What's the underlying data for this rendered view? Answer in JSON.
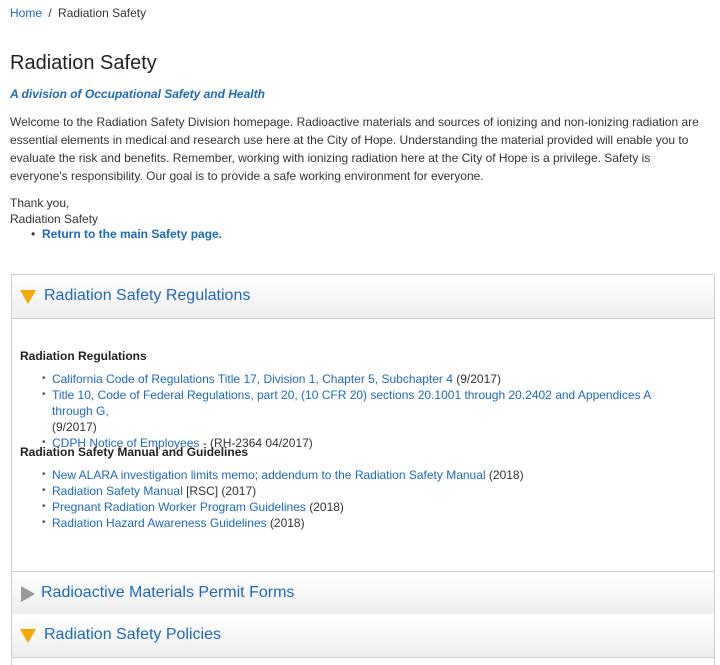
{
  "breadcrumb": {
    "home": "Home",
    "separator": "/",
    "current": "Radiation Safety"
  },
  "page": {
    "title": "Radiation Safety",
    "subtitle": "A division of Occupational Safety and Health",
    "intro": "Welcome to the Radiation Safety Division homepage. Radioactive materials and sources of ionizing and non-ionizing radiation are essential elements in medical and research use here at the City of Hope. Understanding the material provided will enable you to evaluate the risk and benefits. Remember, working with ionizing radiation here at the City of Hope is a privilege. Safety is everyone's responsibility. Our goal is to provide a safe working environment for everyone.",
    "thanks_line": "Thank you,",
    "signature": "Radiation Safety",
    "return_link": "Return to the main Safety page."
  },
  "accordion": {
    "panels": [
      {
        "title": "Radiation Safety Regulations",
        "state": "expanded",
        "arrow_color": "#f5a800"
      },
      {
        "title": "Radioactive Materials Permit Forms",
        "state": "collapsed",
        "arrow_color": "#999999"
      },
      {
        "title": "Radiation Safety Policies",
        "state": "expanded",
        "arrow_color": "#f5a800"
      }
    ],
    "regulations": {
      "heading": "Radiation Regulations",
      "items": [
        {
          "link": "California Code of Regulations Title 17, Division 1, Chapter 5, Subchapter 4",
          "suffix": " (9/2017)"
        },
        {
          "link": "Title 10, Code of Federal Regulations, part 20, (10 CFR 20) sections 20.1001 through 20.2402 and Appendices A through G,",
          "suffix": " (9/2017)"
        },
        {
          "link": "CDPH Notice of Employees",
          "suffix": " - (RH-2364 04/2017)"
        }
      ]
    },
    "manual": {
      "heading": "Radiation Safety Manual and Guidelines",
      "items": [
        {
          "link": "New ALARA investigation limits memo; addendum to the Radiation Safety Manual",
          "suffix": " (2018)"
        },
        {
          "link": "Radiation Safety Manual",
          "suffix": " [RSC] (2017)"
        },
        {
          "link": "Pregnant Radiation Worker Program Guidelines",
          "suffix": " (2018)"
        },
        {
          "link": "Radiation Hazard Awareness Guidelines",
          "suffix": " (2018)"
        }
      ]
    }
  },
  "colors": {
    "link": "#1b6ab5",
    "accent_arrow": "#f5a800",
    "collapsed_arrow": "#999999"
  }
}
